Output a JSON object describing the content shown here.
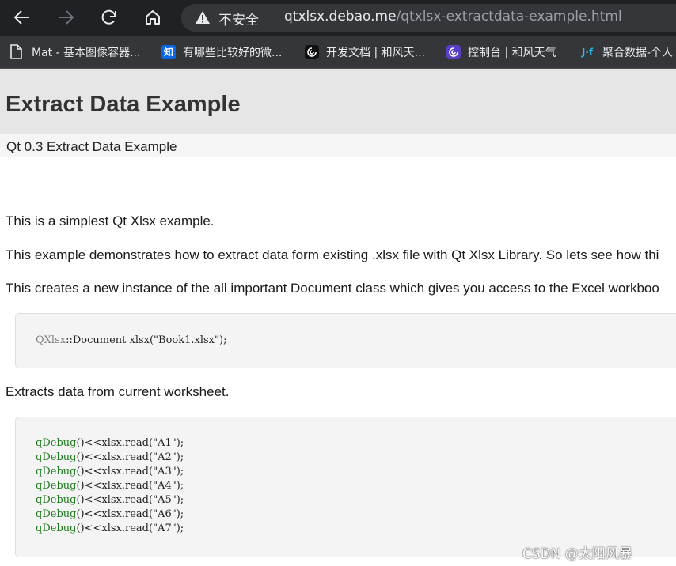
{
  "browser": {
    "security_label": "不安全",
    "url_host": "qtxlsx.debao.me",
    "url_path": "/qtxlsx-extractdata-example.html",
    "bookmarks": [
      {
        "label": "Mat - 基本图像容器...",
        "icon": "page-icon",
        "color": "#35363a"
      },
      {
        "label": "有哪些比较好的微...",
        "icon": "zhihu-icon",
        "glyph": "知",
        "color": "#0a66e4"
      },
      {
        "label": "开发文档 | 和风天...",
        "icon": "hefeng-icon",
        "color": "#111111"
      },
      {
        "label": "控制台 | 和风天气",
        "icon": "hefeng-console-icon",
        "color": "#5b3fc4"
      },
      {
        "label": "聚合数据-个人",
        "icon": "juhe-icon",
        "glyph": "J·f",
        "color": "#35363a"
      }
    ]
  },
  "page": {
    "title": "Extract Data Example",
    "subnav": "Qt 0.3 Extract Data Example",
    "intro": "This is a simplest Qt Xlsx example.",
    "para1": "This example demonstrates how to extract data form existing .xlsx file with Qt Xlsx Library. So lets see how thi",
    "para2": "This creates a new instance of the all important Document class which gives you access to the Excel workboo",
    "code1": {
      "ns": "QXlsx",
      "rest": "::Document xlsx(\"Book1.xlsx\");"
    },
    "para3": "Extracts data from current worksheet.",
    "code2_fn": "qDebug",
    "code2_lines": [
      "()<<xlsx.read(\"A1\");",
      "()<<xlsx.read(\"A2\");",
      "()<<xlsx.read(\"A3\");",
      "()<<xlsx.read(\"A4\");",
      "()<<xlsx.read(\"A5\");",
      "()<<xlsx.read(\"A6\");",
      "()<<xlsx.read(\"A7\");"
    ]
  },
  "watermark": "CSDN @太阳风暴"
}
